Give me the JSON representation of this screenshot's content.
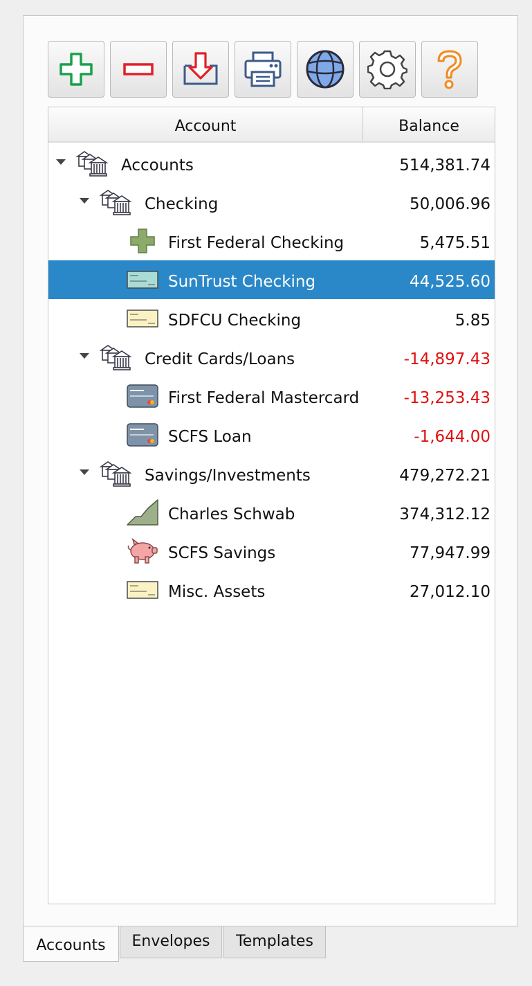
{
  "toolbar": {
    "buttons": [
      {
        "name": "add-account-button",
        "icon": "plus-icon"
      },
      {
        "name": "remove-account-button",
        "icon": "minus-icon"
      },
      {
        "name": "import-button",
        "icon": "download-icon"
      },
      {
        "name": "print-button",
        "icon": "printer-icon"
      },
      {
        "name": "online-button",
        "icon": "globe-icon"
      },
      {
        "name": "settings-button",
        "icon": "gear-icon"
      },
      {
        "name": "help-button",
        "icon": "question-icon"
      }
    ]
  },
  "columns": {
    "account": "Account",
    "balance": "Balance"
  },
  "rows": [
    {
      "label": "Accounts",
      "balance": "514,381.74",
      "icon": "bank-icon",
      "expanded": true
    },
    {
      "label": "Checking",
      "balance": "50,006.96",
      "icon": "bank-icon",
      "expanded": true
    },
    {
      "label": "First Federal Checking",
      "balance": "5,475.51",
      "icon": "green-cross-icon"
    },
    {
      "label": "SunTrust Checking",
      "balance": "44,525.60",
      "icon": "check-icon",
      "selected": true
    },
    {
      "label": "SDFCU Checking",
      "balance": "5.85",
      "icon": "check-icon"
    },
    {
      "label": "Credit Cards/Loans",
      "balance": "-14,897.43",
      "icon": "bank-icon",
      "expanded": true,
      "negative": true
    },
    {
      "label": "First Federal Mastercard",
      "balance": "-13,253.43",
      "icon": "credit-card-icon",
      "negative": true
    },
    {
      "label": "SCFS Loan",
      "balance": "-1,644.00",
      "icon": "credit-card-icon",
      "negative": true
    },
    {
      "label": "Savings/Investments",
      "balance": "479,272.21",
      "icon": "bank-icon",
      "expanded": true
    },
    {
      "label": "Charles Schwab",
      "balance": "374,312.12",
      "icon": "chart-area-icon"
    },
    {
      "label": "SCFS Savings",
      "balance": "77,947.99",
      "icon": "piggy-bank-icon"
    },
    {
      "label": "Misc. Assets",
      "balance": "27,012.10",
      "icon": "check-icon"
    }
  ],
  "tabs": [
    {
      "label": "Accounts",
      "active": true
    },
    {
      "label": "Envelopes"
    },
    {
      "label": "Templates"
    }
  ],
  "colors": {
    "selection": "#2b88c8",
    "negative": "#e01010"
  }
}
